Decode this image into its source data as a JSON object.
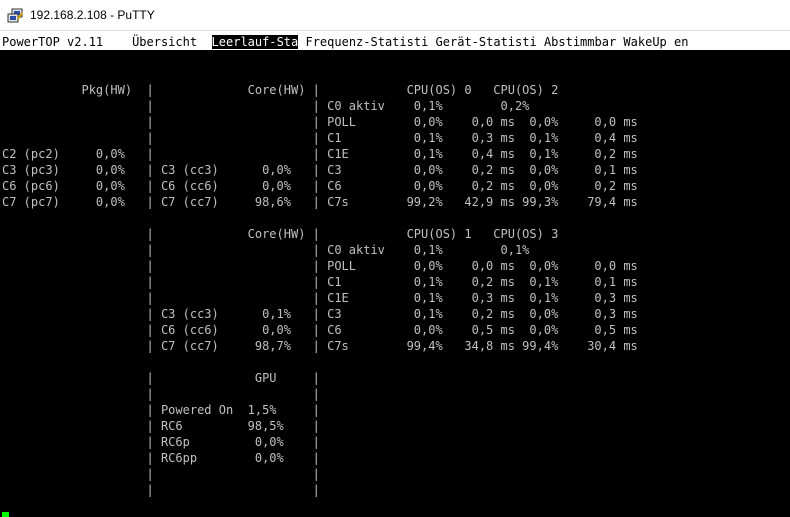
{
  "window": {
    "title": "192.168.2.108 - PuTTY",
    "icon": "putty-icon"
  },
  "tabs": [
    {
      "label": "PowerTOP v2.11",
      "active": false
    },
    {
      "label": "Übersicht",
      "active": false
    },
    {
      "label": "Leerlauf-Sta",
      "active": true
    },
    {
      "label": "Frequenz-Statisti",
      "active": false
    },
    {
      "label": "Gerät-Statisti",
      "active": false
    },
    {
      "label": "Abstimmbar",
      "active": false
    },
    {
      "label": "WakeUp en",
      "active": false
    }
  ],
  "screen_lines": [
    "           Pkg(HW)  |             Core(HW) |            CPU(OS) 0   CPU(OS) 2",
    "                    |                      | C0 aktiv    0,1%        0,2%",
    "                    |                      | POLL        0,0%    0,0 ms  0,0%     0,0 ms",
    "                    |                      | C1          0,1%    0,3 ms  0,1%     0,4 ms",
    "C2 (pc2)     0,0%   |                      | C1E         0,1%    0,4 ms  0,1%     0,2 ms",
    "C3 (pc3)     0,0%   | C3 (cc3)      0,0%   | C3          0,0%    0,2 ms  0,0%     0,1 ms",
    "C6 (pc6)     0,0%   | C6 (cc6)      0,0%   | C6          0,0%    0,2 ms  0,0%     0,2 ms",
    "C7 (pc7)     0,0%   | C7 (cc7)     98,6%   | C7s        99,2%   42,9 ms 99,3%    79,4 ms",
    "",
    "                    |             Core(HW) |            CPU(OS) 1   CPU(OS) 3",
    "                    |                      | C0 aktiv    0,1%        0,1%",
    "                    |                      | POLL        0,0%    0,0 ms  0,0%     0,0 ms",
    "                    |                      | C1          0,1%    0,2 ms  0,1%     0,1 ms",
    "                    |                      | C1E         0,1%    0,3 ms  0,1%     0,3 ms",
    "                    | C3 (cc3)      0,1%   | C3          0,1%    0,2 ms  0,0%     0,3 ms",
    "                    | C6 (cc6)      0,0%   | C6          0,0%    0,5 ms  0,0%     0,5 ms",
    "                    | C7 (cc7)     98,7%   | C7s        99,4%   34,8 ms 99,4%    30,4 ms",
    "",
    "                    |              GPU     |",
    "                    |                      |",
    "                    | Powered On  1,5%     |",
    "                    | RC6         98,5%    |",
    "                    | RC6p         0,0%    |",
    "                    | RC6pp        0,0%    |",
    "                    |                      |",
    "                    |                      |"
  ]
}
